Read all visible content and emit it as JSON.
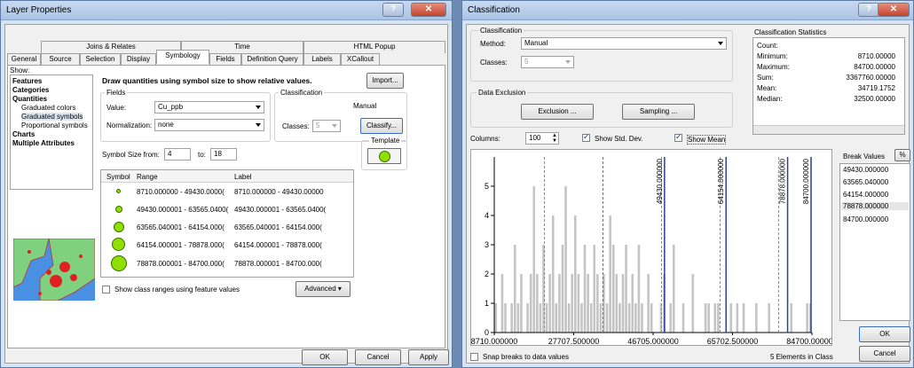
{
  "layer_properties": {
    "title": "Layer Properties",
    "tabs_row1": [
      "Joins & Relates",
      "Time",
      "HTML Popup"
    ],
    "tabs_row2": [
      "General",
      "Source",
      "Selection",
      "Display",
      "Symbology",
      "Fields",
      "Definition Query",
      "Labels",
      "XCallout"
    ],
    "active_tab": "Symbology",
    "show_label": "Show:",
    "tree": [
      {
        "label": "Features",
        "bold": true,
        "indent": 0
      },
      {
        "label": "Categories",
        "bold": true,
        "indent": 0
      },
      {
        "label": "Quantities",
        "bold": true,
        "indent": 0
      },
      {
        "label": "Graduated colors",
        "bold": false,
        "indent": 1
      },
      {
        "label": "Graduated symbols",
        "bold": false,
        "indent": 1
      },
      {
        "label": "Proportional symbols",
        "bold": false,
        "indent": 1
      },
      {
        "label": "Charts",
        "bold": true,
        "indent": 0
      },
      {
        "label": "Multiple Attributes",
        "bold": true,
        "indent": 0
      }
    ],
    "description": "Draw quantities using symbol size to show relative values.",
    "import_label": "Import...",
    "fields_group": "Fields",
    "value_label": "Value:",
    "value_field": "Cu_ppb",
    "normalization_label": "Normalization:",
    "normalization_field": "none",
    "classification_group": "Classification",
    "classification_method": "Manual",
    "classes_label": "Classes:",
    "classes_value": "5",
    "classify_label": "Classify...",
    "symbol_size_label": "Symbol Size from:",
    "symbol_size_from": "4",
    "to_label": "to:",
    "symbol_size_to": "18",
    "template_label": "Template",
    "table_headers": [
      "Symbol",
      "Range",
      "Label"
    ],
    "rows": [
      {
        "range": "8710.000000 - 49430.0000(",
        "label": "8710.000000 - 49430.00000"
      },
      {
        "range": "49430.000001 - 63565.0400(",
        "label": "49430.000001 - 63565.0400("
      },
      {
        "range": "63565.040001 - 64154.000(",
        "label": "63565.040001 - 64154.000("
      },
      {
        "range": "64154.000001 - 78878.000(",
        "label": "64154.000001 - 78878.000("
      },
      {
        "range": "78878.000001 - 84700.000(",
        "label": "78878.000001 - 84700.000("
      }
    ],
    "show_ranges_label": "Show class ranges using feature values",
    "advanced_label": "Advanced",
    "ok_label": "OK",
    "cancel_label": "Cancel",
    "apply_label": "Apply"
  },
  "classification": {
    "title": "Classification",
    "group_label": "Classification",
    "method_label": "Method:",
    "method_value": "Manual",
    "classes_label": "Classes:",
    "classes_value": "5",
    "exclusion_group": "Data Exclusion",
    "exclusion_btn": "Exclusion ...",
    "sampling_btn": "Sampling ...",
    "columns_label": "Columns:",
    "columns_value": "100",
    "show_std_label": "Show Std. Dev.",
    "show_mean_label": "Show Mean",
    "stats_title": "Classification Statistics",
    "stats": [
      {
        "k": "Count:",
        "v": ""
      },
      {
        "k": "Minimum:",
        "v": "8710.00000"
      },
      {
        "k": "Maximum:",
        "v": "84700.00000"
      },
      {
        "k": "Sum:",
        "v": "3367760.00000"
      },
      {
        "k": "Mean:",
        "v": "34719.1752"
      },
      {
        "k": "Median:",
        "v": "32500.00000"
      }
    ],
    "break_values_label": "Break Values",
    "pct_label": "%",
    "break_values": [
      "49430.000000",
      "63565.040000",
      "64154.000000",
      "78878.000000",
      "84700.000000"
    ],
    "selected_break": "78878.000000",
    "ok_label": "OK",
    "cancel_label": "Cancel",
    "snap_label": "Snap breaks to data values",
    "elements_label": "5 Elements in Class",
    "colors": {
      "bar": "#c4c4c4",
      "break": "#2a3f9a",
      "std": "#888888",
      "mean": "#d04040"
    }
  },
  "chart_data": {
    "type": "bar",
    "title": "",
    "xlabel": "",
    "ylabel": "",
    "xlim": [
      8710,
      84700
    ],
    "ylim": [
      0,
      6
    ],
    "x_ticks": [
      "8710.000000",
      "27707.500000",
      "46705.000000",
      "65702.500000",
      "84700.000000"
    ],
    "y_ticks": [
      "0",
      "1",
      "2",
      "3",
      "4",
      "5"
    ],
    "break_values": [
      49430,
      64154,
      78878,
      84700
    ],
    "break_labels": [
      "49430.000000",
      "64154.000000",
      "78878.000000",
      "84700.000000"
    ],
    "values": [
      1,
      0,
      2,
      1,
      0,
      1,
      3,
      1,
      2,
      0,
      1,
      2,
      5,
      2,
      1,
      3,
      1,
      2,
      4,
      1,
      2,
      3,
      5,
      1,
      2,
      4,
      2,
      1,
      3,
      2,
      1,
      3,
      2,
      1,
      2,
      1,
      4,
      3,
      2,
      1,
      2,
      3,
      1,
      2,
      1,
      3,
      1,
      0,
      2,
      1,
      0,
      0,
      1,
      2,
      0,
      1,
      3,
      0,
      0,
      1,
      0,
      0,
      2,
      0,
      0,
      0,
      1,
      1,
      0,
      1,
      1,
      0,
      0,
      0,
      1,
      0,
      1,
      0,
      1,
      0,
      0,
      0,
      1,
      0,
      0,
      0,
      1,
      0,
      0,
      0,
      0,
      0,
      0,
      1,
      0,
      0,
      0,
      0,
      1,
      1
    ]
  }
}
